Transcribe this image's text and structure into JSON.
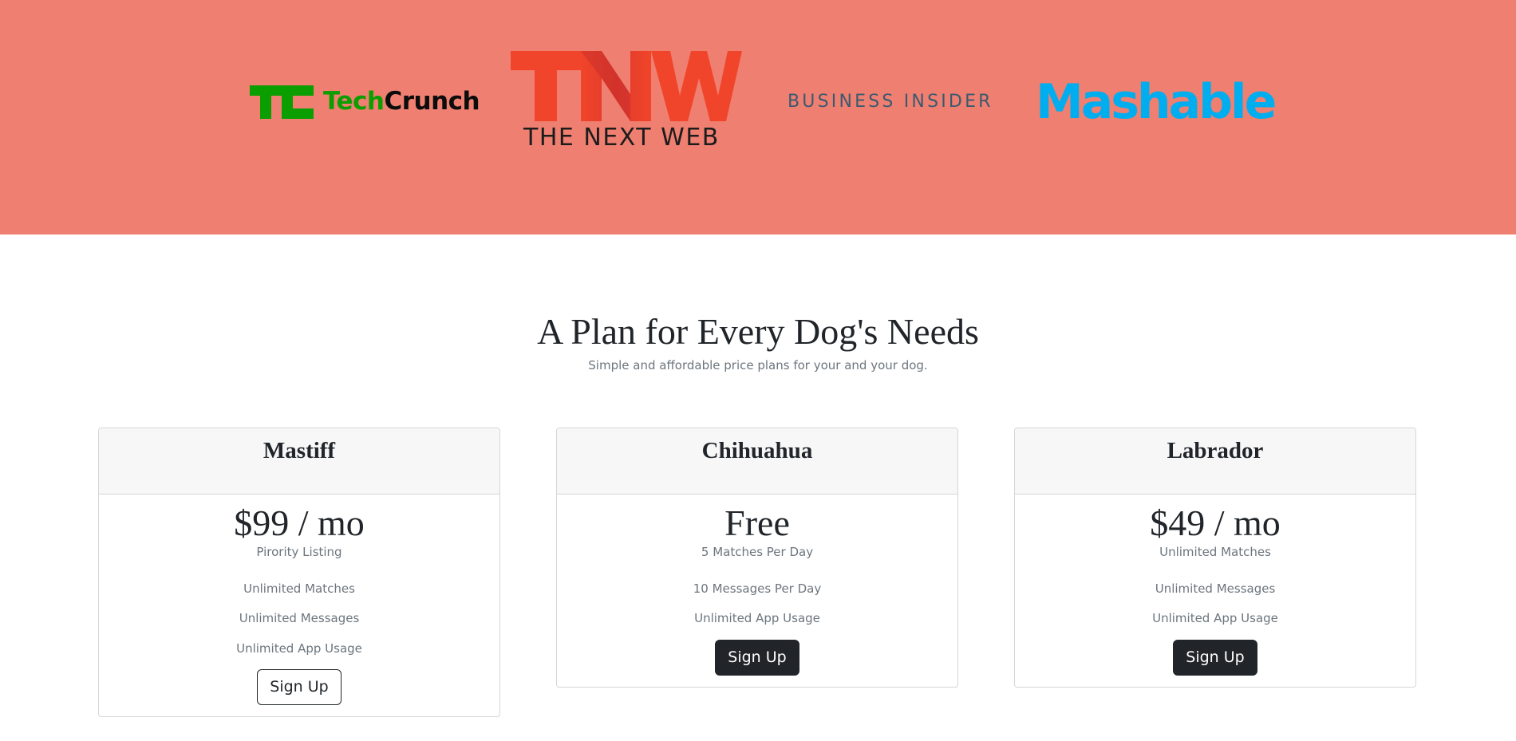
{
  "press": {
    "logos": [
      {
        "name": "TechCrunch",
        "wordmark_tech": "Tech",
        "wordmark_crunch": "Crunch",
        "colors": [
          "#0a9e01",
          "#0c0c0c"
        ]
      },
      {
        "name": "The Next Web",
        "mark": "TNW",
        "wordmark": "THE NEXT WEB",
        "colors": [
          "#f0452a",
          "#1c1c1c"
        ]
      },
      {
        "name": "Business Insider",
        "wordmark": "BUSINESS INSIDER",
        "colors": [
          "#3a5a70"
        ]
      },
      {
        "name": "Mashable",
        "wordmark": "Mashable",
        "colors": [
          "#00aeef"
        ]
      }
    ],
    "background": "#ef7f71"
  },
  "pricing": {
    "title": "A Plan for Every Dog's Needs",
    "subtitle": "Simple and affordable price plans for your and your dog.",
    "plans": [
      {
        "name": "Mastiff",
        "price": "$99 / mo",
        "features": [
          "Pirority Listing",
          "Unlimited Matches",
          "Unlimited Messages",
          "Unlimited App Usage"
        ],
        "button": "Sign Up",
        "button_style": "outline"
      },
      {
        "name": "Chihuahua",
        "price": "Free",
        "features": [
          "5 Matches Per Day",
          "10 Messages Per Day",
          "Unlimited App Usage"
        ],
        "button": "Sign Up",
        "button_style": "dark"
      },
      {
        "name": "Labrador",
        "price": "$49 / mo",
        "features": [
          "Unlimited Matches",
          "Unlimited Messages",
          "Unlimited App Usage"
        ],
        "button": "Sign Up",
        "button_style": "dark"
      }
    ]
  }
}
